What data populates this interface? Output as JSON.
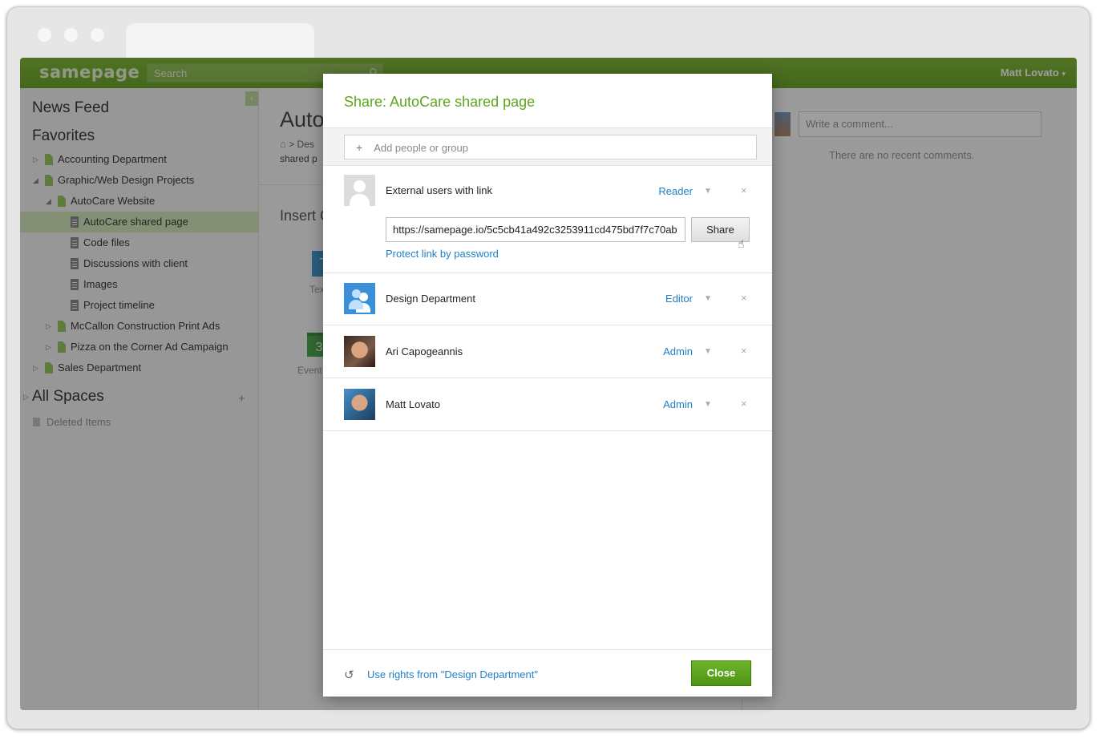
{
  "app": {
    "logo": "samepage",
    "search_placeholder": "Search",
    "user_name": "Matt Lovato",
    "user_caret": "▾"
  },
  "sidebar": {
    "news_feed": "News Feed",
    "favorites": "Favorites",
    "items": [
      {
        "label": "Accounting Department",
        "type": "folder",
        "expander": "▷"
      },
      {
        "label": "Graphic/Web Design Projects",
        "type": "folder",
        "expander": "◢"
      },
      {
        "label": "AutoCare Website",
        "type": "folder",
        "expander": "◢"
      },
      {
        "label": "AutoCare shared page",
        "type": "page",
        "expander": ""
      },
      {
        "label": "Code files",
        "type": "page",
        "expander": ""
      },
      {
        "label": "Discussions with client",
        "type": "page",
        "expander": ""
      },
      {
        "label": "Images",
        "type": "page",
        "expander": ""
      },
      {
        "label": "Project timeline",
        "type": "page",
        "expander": ""
      },
      {
        "label": "McCallon Construction Print Ads",
        "type": "folder",
        "expander": "▷"
      },
      {
        "label": "Pizza on the Corner Ad Campaign",
        "type": "folder",
        "expander": "▷"
      },
      {
        "label": "Sales Department",
        "type": "folder",
        "expander": "▷"
      }
    ],
    "all_spaces": "All Spaces",
    "all_spaces_add": "+",
    "deleted_items": "Deleted Items",
    "collapse_icon": "‹"
  },
  "main": {
    "title_fragment": "Auto",
    "breadcrumb_fragment": "> Des",
    "sub_fragment": "shared p",
    "insert_fragment": "Insert C",
    "tile_text_glyph": "T",
    "tile_text_label": "Tex",
    "tile_cal_glyph": "3",
    "tile_cal_label": "Event"
  },
  "comments": {
    "placeholder": "Write a comment...",
    "empty_text": "There are no recent comments."
  },
  "dialog": {
    "title": "Share: AutoCare shared page",
    "add_placeholder": "Add people or group",
    "add_plus": "+",
    "entries": [
      {
        "name": "External users with link",
        "role": "Reader",
        "avatar": "generic-user-icon"
      },
      {
        "name": "Design Department",
        "role": "Editor",
        "avatar": "group-icon"
      },
      {
        "name": "Ari Capogeannis",
        "role": "Admin",
        "avatar": "user-photo"
      },
      {
        "name": "Matt Lovato",
        "role": "Admin",
        "avatar": "user-photo"
      }
    ],
    "caret": "▼",
    "remove": "×",
    "share_link": "https://samepage.io/5c5cb41a492c3253911cd475bd7f7c70ab",
    "share_button": "Share",
    "protect_link": "Protect link by password",
    "use_rights": "Use rights from \"Design Department\"",
    "close_button": "Close",
    "accent_color": "#5ea51d",
    "link_color": "#1f7fc4"
  }
}
